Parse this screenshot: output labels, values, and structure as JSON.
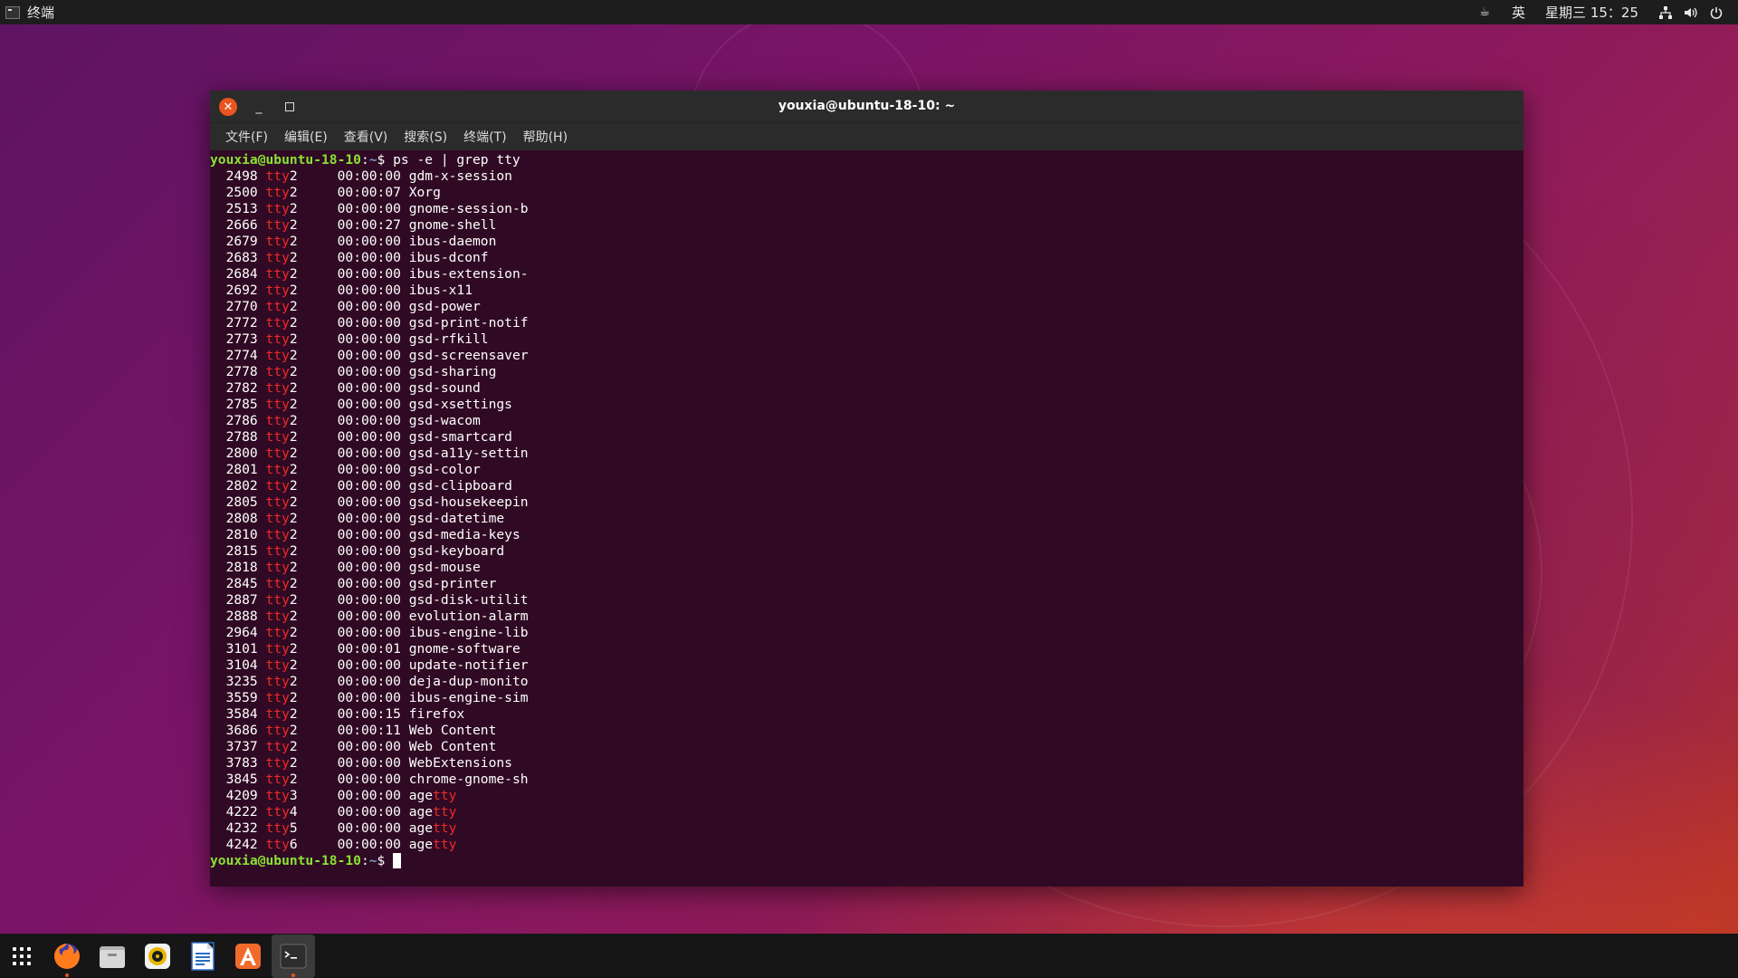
{
  "topbar": {
    "app_name": "终端",
    "input_method": "英",
    "clock": "星期三 15：25"
  },
  "window": {
    "title": "youxia@ubuntu-18-10: ~"
  },
  "menubar": {
    "items": [
      "文件(F)",
      "编辑(E)",
      "查看(V)",
      "搜索(S)",
      "终端(T)",
      "帮助(H)"
    ]
  },
  "terminal": {
    "prompt_user_host": "youxia@ubuntu-18-10",
    "prompt_path": "~",
    "prompt_symbol": "$ ",
    "command": "ps -e | grep tty",
    "processes": [
      {
        "pid": "2498",
        "tty": "tty2",
        "time": "00:00:00",
        "cmd": "gdm-x-session"
      },
      {
        "pid": "2500",
        "tty": "tty2",
        "time": "00:00:07",
        "cmd": "Xorg"
      },
      {
        "pid": "2513",
        "tty": "tty2",
        "time": "00:00:00",
        "cmd": "gnome-session-b"
      },
      {
        "pid": "2666",
        "tty": "tty2",
        "time": "00:00:27",
        "cmd": "gnome-shell"
      },
      {
        "pid": "2679",
        "tty": "tty2",
        "time": "00:00:00",
        "cmd": "ibus-daemon"
      },
      {
        "pid": "2683",
        "tty": "tty2",
        "time": "00:00:00",
        "cmd": "ibus-dconf"
      },
      {
        "pid": "2684",
        "tty": "tty2",
        "time": "00:00:00",
        "cmd": "ibus-extension-"
      },
      {
        "pid": "2692",
        "tty": "tty2",
        "time": "00:00:00",
        "cmd": "ibus-x11"
      },
      {
        "pid": "2770",
        "tty": "tty2",
        "time": "00:00:00",
        "cmd": "gsd-power"
      },
      {
        "pid": "2772",
        "tty": "tty2",
        "time": "00:00:00",
        "cmd": "gsd-print-notif"
      },
      {
        "pid": "2773",
        "tty": "tty2",
        "time": "00:00:00",
        "cmd": "gsd-rfkill"
      },
      {
        "pid": "2774",
        "tty": "tty2",
        "time": "00:00:00",
        "cmd": "gsd-screensaver"
      },
      {
        "pid": "2778",
        "tty": "tty2",
        "time": "00:00:00",
        "cmd": "gsd-sharing"
      },
      {
        "pid": "2782",
        "tty": "tty2",
        "time": "00:00:00",
        "cmd": "gsd-sound"
      },
      {
        "pid": "2785",
        "tty": "tty2",
        "time": "00:00:00",
        "cmd": "gsd-xsettings"
      },
      {
        "pid": "2786",
        "tty": "tty2",
        "time": "00:00:00",
        "cmd": "gsd-wacom"
      },
      {
        "pid": "2788",
        "tty": "tty2",
        "time": "00:00:00",
        "cmd": "gsd-smartcard"
      },
      {
        "pid": "2800",
        "tty": "tty2",
        "time": "00:00:00",
        "cmd": "gsd-a11y-settin"
      },
      {
        "pid": "2801",
        "tty": "tty2",
        "time": "00:00:00",
        "cmd": "gsd-color"
      },
      {
        "pid": "2802",
        "tty": "tty2",
        "time": "00:00:00",
        "cmd": "gsd-clipboard"
      },
      {
        "pid": "2805",
        "tty": "tty2",
        "time": "00:00:00",
        "cmd": "gsd-housekeepin"
      },
      {
        "pid": "2808",
        "tty": "tty2",
        "time": "00:00:00",
        "cmd": "gsd-datetime"
      },
      {
        "pid": "2810",
        "tty": "tty2",
        "time": "00:00:00",
        "cmd": "gsd-media-keys"
      },
      {
        "pid": "2815",
        "tty": "tty2",
        "time": "00:00:00",
        "cmd": "gsd-keyboard"
      },
      {
        "pid": "2818",
        "tty": "tty2",
        "time": "00:00:00",
        "cmd": "gsd-mouse"
      },
      {
        "pid": "2845",
        "tty": "tty2",
        "time": "00:00:00",
        "cmd": "gsd-printer"
      },
      {
        "pid": "2887",
        "tty": "tty2",
        "time": "00:00:00",
        "cmd": "gsd-disk-utilit"
      },
      {
        "pid": "2888",
        "tty": "tty2",
        "time": "00:00:00",
        "cmd": "evolution-alarm"
      },
      {
        "pid": "2964",
        "tty": "tty2",
        "time": "00:00:00",
        "cmd": "ibus-engine-lib"
      },
      {
        "pid": "3101",
        "tty": "tty2",
        "time": "00:00:01",
        "cmd": "gnome-software"
      },
      {
        "pid": "3104",
        "tty": "tty2",
        "time": "00:00:00",
        "cmd": "update-notifier"
      },
      {
        "pid": "3235",
        "tty": "tty2",
        "time": "00:00:00",
        "cmd": "deja-dup-monito"
      },
      {
        "pid": "3559",
        "tty": "tty2",
        "time": "00:00:00",
        "cmd": "ibus-engine-sim"
      },
      {
        "pid": "3584",
        "tty": "tty2",
        "time": "00:00:15",
        "cmd": "firefox"
      },
      {
        "pid": "3686",
        "tty": "tty2",
        "time": "00:00:11",
        "cmd": "Web Content"
      },
      {
        "pid": "3737",
        "tty": "tty2",
        "time": "00:00:00",
        "cmd": "Web Content"
      },
      {
        "pid": "3783",
        "tty": "tty2",
        "time": "00:00:00",
        "cmd": "WebExtensions"
      },
      {
        "pid": "3845",
        "tty": "tty2",
        "time": "00:00:00",
        "cmd": "chrome-gnome-sh"
      },
      {
        "pid": "4209",
        "tty": "tty3",
        "time": "00:00:00",
        "cmd": "agetty"
      },
      {
        "pid": "4222",
        "tty": "tty4",
        "time": "00:00:00",
        "cmd": "agetty"
      },
      {
        "pid": "4232",
        "tty": "tty5",
        "time": "00:00:00",
        "cmd": "agetty"
      },
      {
        "pid": "4242",
        "tty": "tty6",
        "time": "00:00:00",
        "cmd": "agetty"
      }
    ],
    "highlight_term": "tty"
  },
  "dock": {
    "items": [
      {
        "name": "show-applications",
        "icon": "grid-icon",
        "active": false
      },
      {
        "name": "firefox",
        "icon": "firefox-icon",
        "active": false,
        "running": true
      },
      {
        "name": "files",
        "icon": "files-icon",
        "active": false
      },
      {
        "name": "rhythmbox",
        "icon": "rhythmbox-icon",
        "active": false
      },
      {
        "name": "libreoffice-writer",
        "icon": "writer-icon",
        "active": false
      },
      {
        "name": "ubuntu-software",
        "icon": "software-icon",
        "active": false
      },
      {
        "name": "terminal",
        "icon": "terminal-icon",
        "active": true,
        "running": true
      }
    ]
  },
  "colors": {
    "terminal_bg": "#300a24",
    "prompt_green": "#8ae234",
    "path_blue": "#729fcf",
    "grep_match_red": "#ef2929",
    "accent_orange": "#e95420"
  }
}
